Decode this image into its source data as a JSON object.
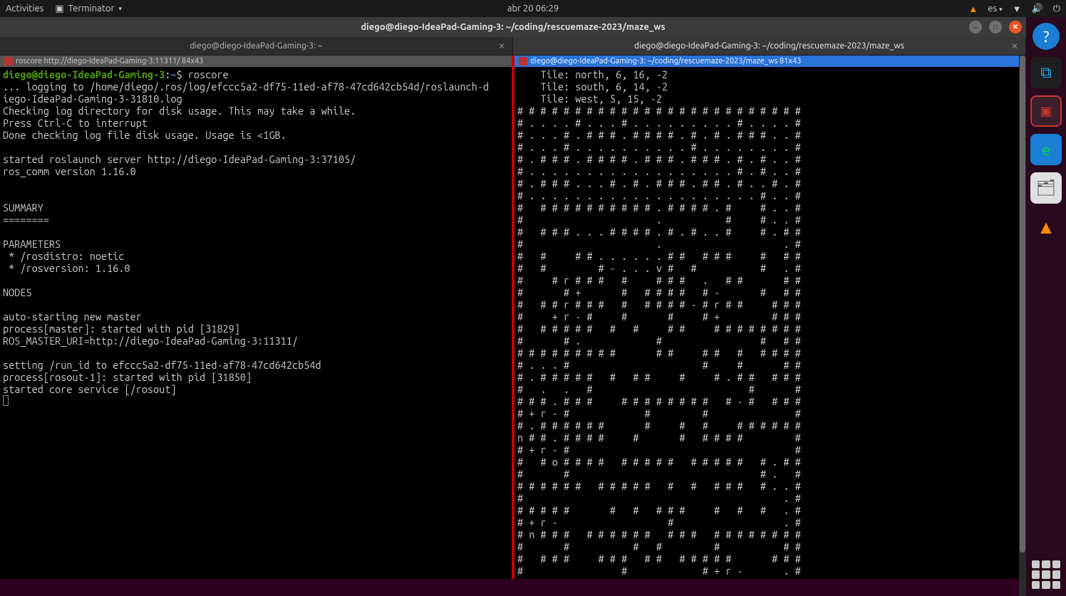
{
  "topbar": {
    "activities": "Activities",
    "app_name": "Terminator",
    "datetime": "abr 20  06:29",
    "lang": "es"
  },
  "window": {
    "title": "diego@diego-IdeaPad-Gaming-3: ~/coding/rescuemaze-2023/maze_ws"
  },
  "tabs": [
    {
      "label": "diego@diego-IdeaPad-Gaming-3: ~",
      "active": false
    },
    {
      "label": "diego@diego-IdeaPad-Gaming-3: ~/coding/rescuemaze-2023/maze_ws",
      "active": true
    }
  ],
  "left_pane": {
    "title": "roscore http://diego-IdeaPad-Gaming-3:11311/ 84x43",
    "prompt_user": "diego@diego-IdeaPad-Gaming-3",
    "prompt_path": "~",
    "prompt_cmd": "roscore",
    "lines": [
      "... logging to /home/diego/.ros/log/efccc5a2-df75-11ed-af78-47cd642cb54d/roslaunch-d",
      "iego-IdeaPad-Gaming-3-31810.log",
      "Checking log directory for disk usage. This may take a while.",
      "Press Ctrl-C to interrupt",
      "Done checking log file disk usage. Usage is <1GB.",
      "",
      "started roslaunch server http://diego-IdeaPad-Gaming-3:37105/",
      "ros_comm version 1.16.0",
      "",
      "",
      "SUMMARY",
      "========",
      "",
      "PARAMETERS",
      " * /rosdistro: noetic",
      " * /rosversion: 1.16.0",
      "",
      "NODES",
      "",
      "auto-starting new master",
      "process[master]: started with pid [31829]",
      "ROS_MASTER_URI=http://diego-IdeaPad-Gaming-3:11311/",
      "",
      "setting /run_id to efccc5a2-df75-11ed-af78-47cd642cb54d",
      "process[rosout-1]: started with pid [31850]",
      "started core service [/rosout]"
    ]
  },
  "right_pane": {
    "title": "diego@diego-IdeaPad-Gaming-3: ~/coding/rescuemaze-2023/maze_ws 81x43",
    "header_lines": [
      "    Tile: north, 6, 16, -2",
      "    Tile: south, 6, 14, -2",
      "    Tile: west, 5, 15, -2"
    ],
    "maze": [
      "# # # # # # # # # # # # # # # # # # # # # # # # #",
      "# . . . . # . . . # . . . . . . . . . # . . . . #",
      "# . . . # . # # # . # # # # . # . # . # # # . . #",
      "# . . . # . . . . . . . . . . # . . . . . . . . #",
      "# . # # # . # # # # . # # # . # # # . # . # . . #",
      "# . . . . . . . . . . . . . . . . . . # . # . . #",
      "# . # # # . . . # . # . # # # . # # . # . . # . #",
      "# . . . . . . . . . . . . . . . . . . . . # . . #",
      "#   # # # # # # # # # # . # # # # . #     # . . #",
      "#                       .           #     # . . #",
      "#   # # # . . . # # # # . # . # . . #     # . # #",
      "#                       .                     . #",
      "#   #     # # . . . . . . # #   # # #     #   # #",
      "#   #         # - . . . v #   #           #   . #",
      "#     # r # # #   #     # # #   .   # #       # #",
      "#       # +       #   # # # #   # -       #   # #",
      "#   # # r # # #   #   # # # # - # r # #     # # #",
      "#     + r - #     #       #     # +         # # #",
      "#   # # # # #   #   #     # #     # # # # # # # #",
      "#       # .             #                 #   # #",
      "# # # # # # # # #       # #     # #   #   # # # #",
      "# . . . #                       #     #       # #",
      "# . # # # # #   #   # #     #     # . # #   # # #",
      "#   .   .   #                           #       #",
      "# # # . # # #     # # # # # # # #   # - #   # # #",
      "# + r - #             #         #               #",
      "# . # # # # # #       #     #   #     # # # # # #",
      "n # # . # # # #     #       #   # # # #         #",
      "# + r - #                                       #",
      "#   # o # # # #   # # # # #   # # # # #   # . # #",
      "#       #                                 # .   #",
      "# # # # # #   # # # # #   #   #   # # #   # . . #",
      "#                                             . #",
      "# # # # #       #   #   # # #     #   #   #   . #",
      "# + r -                   #                   . #",
      "# n # # #   # # # # # #   # # #   # # # # # # # #",
      "#       #           #   #         #           # #",
      "#   # # #     # # #   # #   # # # # #       # # #",
      "#                 #             # + r -       . #",
      "# # # #   #   # # # # #   # #   #   #   #   # # #",
      "#                     #       .               . #",
      "# # #   # # # # # # # # . # # # # # # # # # # # #"
    ]
  }
}
